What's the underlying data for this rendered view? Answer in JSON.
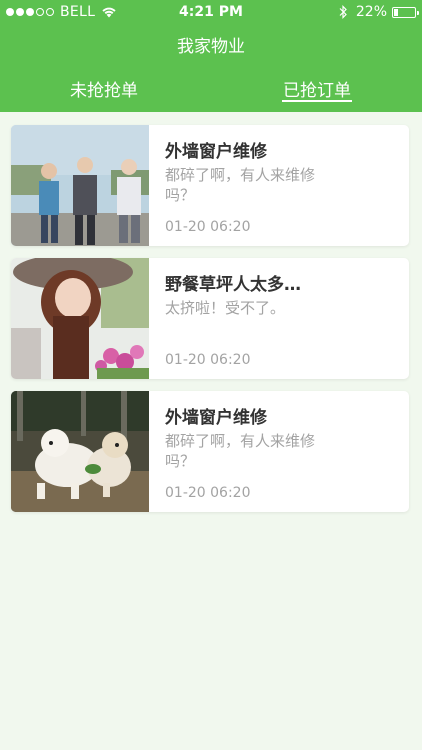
{
  "status_bar": {
    "carrier": "BELL",
    "time": "4:21 PM",
    "battery": "22%",
    "battery_level": 0.22,
    "icons": [
      "signal-dots-icon",
      "wifi-icon",
      "bluetooth-icon",
      "battery-icon"
    ]
  },
  "header": {
    "title": "我家物业",
    "tabs": [
      {
        "label": "未抢抢单",
        "active": false
      },
      {
        "label": "已抢订单",
        "active": true
      }
    ]
  },
  "orders": [
    {
      "title": "外墙窗户维修",
      "description": "都碎了啊，有人来维修吗？",
      "time": "01-20 06:20",
      "image": "three-women-outdoors"
    },
    {
      "title": "野餐草坪人太多…",
      "description": "太挤啦！受不了。",
      "time": "01-20 06:20",
      "image": "woman-with-hat-flowers"
    },
    {
      "title": "外墙窗户维修",
      "description": "都碎了啊，有人来维修吗？",
      "time": "01-20 06:20",
      "image": "two-white-puppies"
    }
  ],
  "colors": {
    "header_green": "#5cc14f",
    "background": "#f1f8ee",
    "title_text": "#333333",
    "secondary_text": "#a3a3a3"
  }
}
